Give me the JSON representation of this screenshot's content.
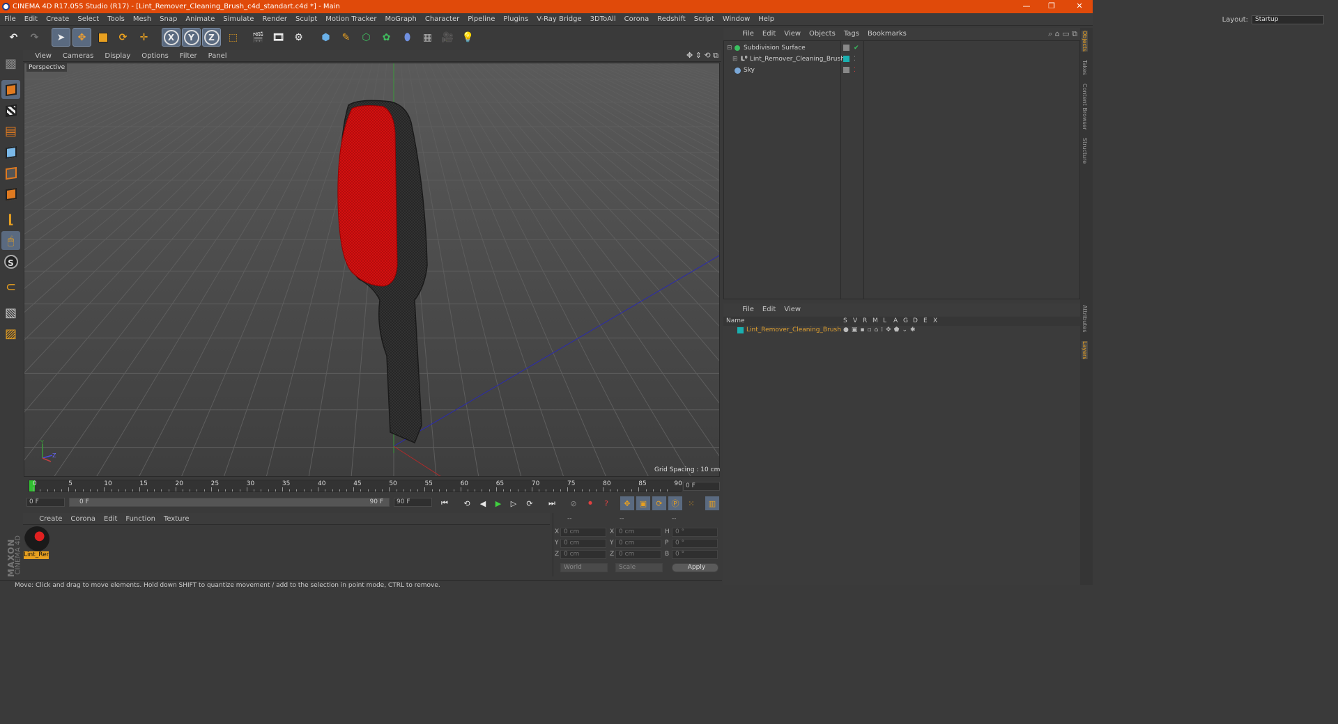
{
  "window": {
    "title": "CINEMA 4D R17.055 Studio (R17) - [Lint_Remover_Cleaning_Brush_c4d_standart.c4d *] - Main",
    "controls": [
      "—",
      "❐",
      "✕"
    ]
  },
  "menubar": {
    "items": [
      "File",
      "Edit",
      "Create",
      "Select",
      "Tools",
      "Mesh",
      "Snap",
      "Animate",
      "Simulate",
      "Render",
      "Sculpt",
      "Motion Tracker",
      "MoGraph",
      "Character",
      "Pipeline",
      "Plugins",
      "V-Ray Bridge",
      "3DToAll",
      "Corona",
      "Redshift",
      "Script",
      "Window",
      "Help"
    ],
    "layout_label": "Layout:",
    "layout_value": "Startup"
  },
  "toolbar": {
    "axis_x": "X",
    "axis_y": "Y",
    "axis_z": "Z"
  },
  "viewport": {
    "menu": [
      "View",
      "Cameras",
      "Display",
      "Options",
      "Filter",
      "Panel"
    ],
    "label": "Perspective",
    "grid_spacing": "Grid Spacing : 10 cm",
    "axis_y": "Y",
    "axis_z": "Z"
  },
  "timeline": {
    "ticks": [
      "0",
      "5",
      "10",
      "15",
      "20",
      "25",
      "30",
      "35",
      "40",
      "45",
      "50",
      "55",
      "60",
      "65",
      "70",
      "75",
      "80",
      "85",
      "90"
    ],
    "current_frame": "0 F",
    "start_field": "0 F",
    "range_start": "0 F",
    "range_end": "90 F",
    "end_field": "90 F"
  },
  "material_panel": {
    "menu": [
      "Create",
      "Corona",
      "Edit",
      "Function",
      "Texture"
    ],
    "material_name": "Lint_Rer"
  },
  "coordinates": {
    "headers": [
      "--",
      "--",
      "--"
    ],
    "rows": [
      {
        "l1": "X",
        "v1": "0 cm",
        "l2": "X",
        "v2": "0 cm",
        "l3": "H",
        "v3": "0 °"
      },
      {
        "l1": "Y",
        "v1": "0 cm",
        "l2": "Y",
        "v2": "0 cm",
        "l3": "P",
        "v3": "0 °"
      },
      {
        "l1": "Z",
        "v1": "0 cm",
        "l2": "Z",
        "v2": "0 cm",
        "l3": "B",
        "v3": "0 °"
      }
    ],
    "mode": "World",
    "scale": "Scale",
    "apply": "Apply"
  },
  "status": "Move: Click and drag to move elements. Hold down SHIFT to quantize movement / add to the selection in point mode, CTRL to remove.",
  "objects_panel": {
    "menu": [
      "File",
      "Edit",
      "View",
      "Objects",
      "Tags",
      "Bookmarks"
    ],
    "items": [
      {
        "name": "Subdivision Surface",
        "color": "#3ac060"
      },
      {
        "name": "Lint_Remover_Cleaning_Brush",
        "color": "#d0d0d0"
      },
      {
        "name": "Sky",
        "color": "#7aa8d8"
      }
    ]
  },
  "layers_panel": {
    "menu": [
      "File",
      "Edit",
      "View"
    ],
    "headers": [
      "Name",
      "S",
      "V",
      "R",
      "M",
      "L",
      "A",
      "G",
      "D",
      "E",
      "X"
    ],
    "layer_name": "Lint_Remover_Cleaning_Brush"
  },
  "side_tabs": [
    "Objects",
    "Takes",
    "Content Browser",
    "Structure",
    "Attributes",
    "Layers"
  ],
  "brand": {
    "maxon": "MAXON",
    "cinema": "CINEMA 4D"
  },
  "colors": {
    "title_bar": "#e04a0a",
    "accent": "#e07a20",
    "brush_pad": "#e01010",
    "layer_text": "#e0a030"
  }
}
